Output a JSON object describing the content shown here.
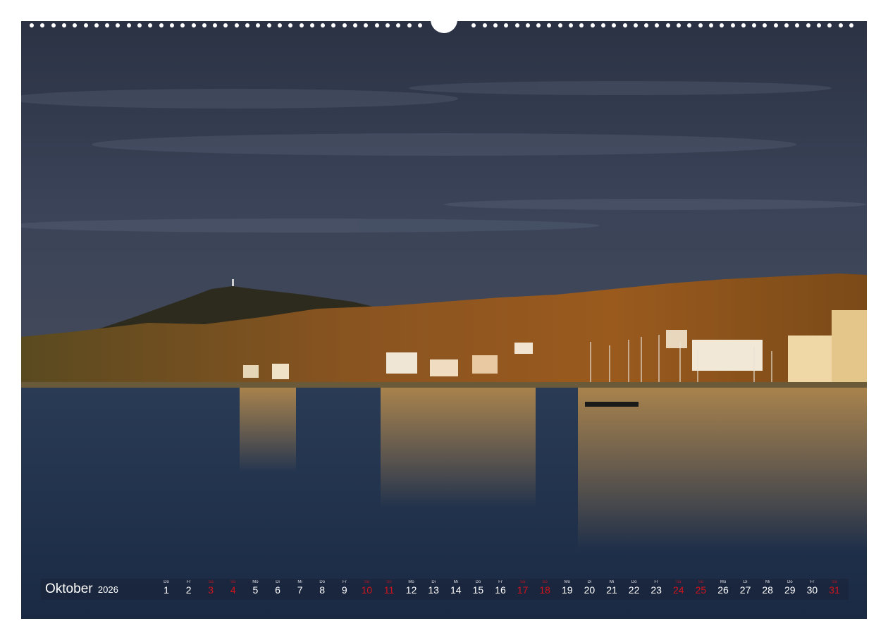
{
  "calendar": {
    "month": "Oktober",
    "year": "2026",
    "days": [
      {
        "wd": "Do",
        "d": "1",
        "we": false
      },
      {
        "wd": "Fr",
        "d": "2",
        "we": false
      },
      {
        "wd": "Sa",
        "d": "3",
        "we": true
      },
      {
        "wd": "So",
        "d": "4",
        "we": true
      },
      {
        "wd": "Mo",
        "d": "5",
        "we": false
      },
      {
        "wd": "Di",
        "d": "6",
        "we": false
      },
      {
        "wd": "Mi",
        "d": "7",
        "we": false
      },
      {
        "wd": "Do",
        "d": "8",
        "we": false
      },
      {
        "wd": "Fr",
        "d": "9",
        "we": false
      },
      {
        "wd": "Sa",
        "d": "10",
        "we": true
      },
      {
        "wd": "So",
        "d": "11",
        "we": true
      },
      {
        "wd": "Mo",
        "d": "12",
        "we": false
      },
      {
        "wd": "Di",
        "d": "13",
        "we": false
      },
      {
        "wd": "Mi",
        "d": "14",
        "we": false
      },
      {
        "wd": "Do",
        "d": "15",
        "we": false
      },
      {
        "wd": "Fr",
        "d": "16",
        "we": false
      },
      {
        "wd": "Sa",
        "d": "17",
        "we": true
      },
      {
        "wd": "So",
        "d": "18",
        "we": true
      },
      {
        "wd": "Mo",
        "d": "19",
        "we": false
      },
      {
        "wd": "Di",
        "d": "20",
        "we": false
      },
      {
        "wd": "Mi",
        "d": "21",
        "we": false
      },
      {
        "wd": "Do",
        "d": "22",
        "we": false
      },
      {
        "wd": "Fr",
        "d": "23",
        "we": false
      },
      {
        "wd": "Sa",
        "d": "24",
        "we": true
      },
      {
        "wd": "So",
        "d": "25",
        "we": true
      },
      {
        "wd": "Mo",
        "d": "26",
        "we": false
      },
      {
        "wd": "Di",
        "d": "27",
        "we": false
      },
      {
        "wd": "Mi",
        "d": "28",
        "we": false
      },
      {
        "wd": "Do",
        "d": "29",
        "we": false
      },
      {
        "wd": "Fr",
        "d": "30",
        "we": false
      },
      {
        "wd": "Sa",
        "d": "31",
        "we": true
      }
    ]
  },
  "colors": {
    "sky": "#2c3447",
    "water": "#1f3350",
    "hills": "#7a4a1c",
    "weekend": "#d0141c"
  }
}
